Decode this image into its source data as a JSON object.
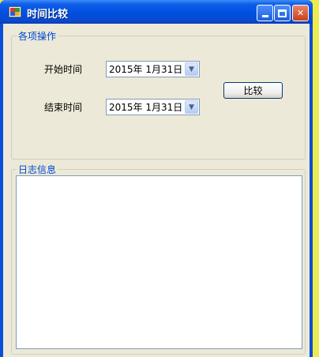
{
  "window": {
    "title": "时间比较",
    "controls": {
      "minimize": "minimize",
      "maximize": "maximize",
      "close": "✕"
    }
  },
  "ops_group": {
    "legend": "各项操作",
    "start_label": "开始时间",
    "start_value": "2015年  1月31日",
    "end_label": "结束时间",
    "end_value": "2015年  1月31日",
    "compare_button": "比较"
  },
  "log_group": {
    "legend": "日志信息",
    "content": ""
  },
  "icons": {
    "app": "app-icon",
    "dropdown": "chevron-down-icon"
  },
  "colors": {
    "titlebar": "#0050e0",
    "client_bg": "#ece9d8",
    "legend_text": "#0046d5",
    "desktop": "#ecec4c"
  }
}
